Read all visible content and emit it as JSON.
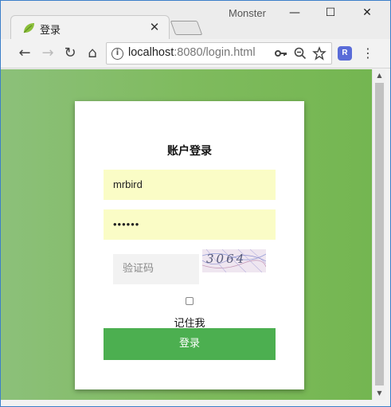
{
  "browser": {
    "tab_title": "登录",
    "tab_close": "✕",
    "profile_name": "Monster",
    "window_controls": {
      "minimize": "—",
      "maximize": "☐",
      "close": "✕"
    },
    "url_host": "localhost",
    "url_rest": ":8080/login.html",
    "nav": {
      "back": "←",
      "forward": "→",
      "reload": "↻",
      "home": "⌂"
    },
    "omnibox_icons": [
      "key-icon",
      "zoom-out-icon",
      "star-icon"
    ],
    "extension_label": "R",
    "menu": "⋮"
  },
  "login": {
    "title": "账户登录",
    "username_value": "mrbird",
    "password_value": "••••••",
    "captcha_placeholder": "验证码",
    "captcha_text": "3064",
    "remember_label": "记住我",
    "remember_checked": false,
    "submit_label": "登录"
  },
  "colors": {
    "background_green": "#7fbb5e",
    "button_green": "#4caf50",
    "autofill_yellow": "#fafcc6"
  }
}
